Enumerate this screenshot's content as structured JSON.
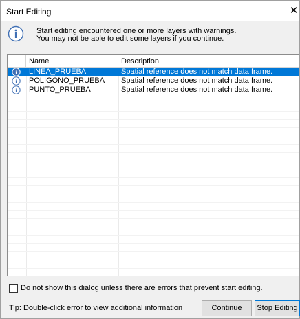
{
  "window": {
    "title": "Start Editing",
    "close_glyph": "✕"
  },
  "banner": {
    "icon": "info-icon",
    "line1": "Start editing encountered one or more layers with warnings.",
    "line2": "You may not be able to edit some layers if you continue."
  },
  "grid": {
    "columns": [
      "",
      "Name",
      "Description"
    ],
    "rows": [
      {
        "icon": "info-icon",
        "name": "LINEA_PRUEBA",
        "description": "Spatial reference does not match data frame.",
        "selected": true
      },
      {
        "icon": "info-icon",
        "name": "POLIGONO_PRUEBA",
        "description": "Spatial reference does not match data frame.",
        "selected": false
      },
      {
        "icon": "info-icon",
        "name": "PUNTO_PRUEBA",
        "description": "Spatial reference does not match data frame.",
        "selected": false
      }
    ]
  },
  "footer": {
    "checkbox_label": "Do not show this dialog unless there are errors that prevent start editing.",
    "checkbox_checked": false,
    "tip": "Tip: Double-click error to view additional information",
    "continue_label": "Continue",
    "stop_label": "Stop Editing"
  },
  "colors": {
    "selection": "#0078d7",
    "icon_blue": "#3f6fb4"
  }
}
